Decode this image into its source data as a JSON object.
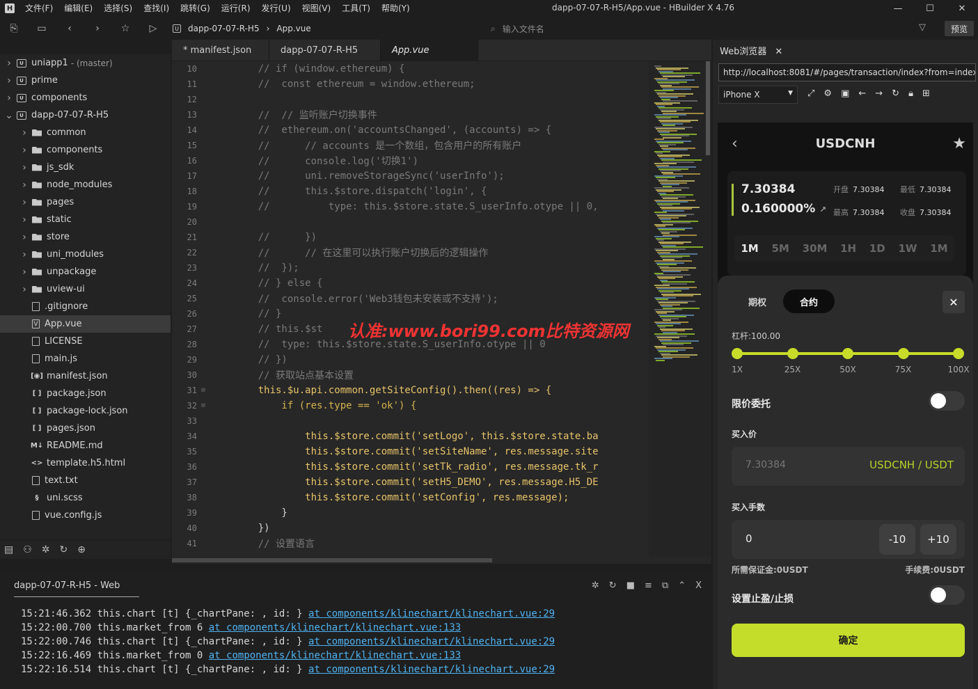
{
  "window": {
    "title": "dapp-07-07-R-H5/App.vue - HBuilder X 4.76",
    "menu": [
      "文件(F)",
      "编辑(E)",
      "选择(S)",
      "查找(I)",
      "跳转(G)",
      "运行(R)",
      "发行(U)",
      "视图(V)",
      "工具(T)",
      "帮助(Y)"
    ]
  },
  "toolbar": {
    "crumb_project": "dapp-07-07-R-H5",
    "crumb_file": "App.vue",
    "file_search_placeholder": "输入文件名",
    "preview_label": "预览"
  },
  "sidebar": {
    "items": [
      {
        "label": "uniapp1",
        "sub": "- (master)",
        "type": "project",
        "arrow": "right"
      },
      {
        "label": "prime",
        "type": "project",
        "arrow": "right"
      },
      {
        "label": "components",
        "type": "project",
        "arrow": "right"
      },
      {
        "label": "dapp-07-07-R-H5",
        "type": "project",
        "arrow": "down"
      },
      {
        "label": "common",
        "type": "folder",
        "arrow": "right"
      },
      {
        "label": "components",
        "type": "folder",
        "arrow": "right"
      },
      {
        "label": "js_sdk",
        "type": "folder",
        "arrow": "right"
      },
      {
        "label": "node_modules",
        "type": "folder",
        "arrow": "right"
      },
      {
        "label": "pages",
        "type": "folder",
        "arrow": "right"
      },
      {
        "label": "static",
        "type": "folder",
        "arrow": "right"
      },
      {
        "label": "store",
        "type": "folder",
        "arrow": "right"
      },
      {
        "label": "uni_modules",
        "type": "folder",
        "arrow": "right"
      },
      {
        "label": "unpackage",
        "type": "folder",
        "arrow": "right"
      },
      {
        "label": "uview-ui",
        "type": "folder",
        "arrow": "right"
      },
      {
        "label": ".gitignore",
        "type": "file"
      },
      {
        "label": "App.vue",
        "type": "vue",
        "selected": true
      },
      {
        "label": "LICENSE",
        "type": "file"
      },
      {
        "label": "main.js",
        "type": "file"
      },
      {
        "label": "manifest.json",
        "type": "manifest"
      },
      {
        "label": "package.json",
        "type": "json"
      },
      {
        "label": "package-lock.json",
        "type": "json"
      },
      {
        "label": "pages.json",
        "type": "json"
      },
      {
        "label": "README.md",
        "type": "md"
      },
      {
        "label": "template.h5.html",
        "type": "html"
      },
      {
        "label": "text.txt",
        "type": "file"
      },
      {
        "label": "uni.scss",
        "type": "scss"
      },
      {
        "label": "vue.config.js",
        "type": "file"
      }
    ]
  },
  "editor": {
    "tabs": [
      {
        "label": "* manifest.json",
        "active": false
      },
      {
        "label": "dapp-07-07-R-H5",
        "active": false
      },
      {
        "label": "App.vue",
        "active": true
      }
    ],
    "lines": [
      {
        "n": "10",
        "t": "    // if (window.ethereum) {"
      },
      {
        "n": "11",
        "t": "    //  const ethereum = window.ethereum;"
      },
      {
        "n": "12",
        "t": ""
      },
      {
        "n": "13",
        "t": "    //  // 监听账户切换事件"
      },
      {
        "n": "14",
        "t": "    //  ethereum.on('accountsChanged', (accounts) => {"
      },
      {
        "n": "15",
        "t": "    //      // accounts 是一个数组，包含用户的所有账户"
      },
      {
        "n": "16",
        "t": "    //      console.log('切换1')"
      },
      {
        "n": "17",
        "t": "    //      uni.removeStorageSync('userInfo');"
      },
      {
        "n": "18",
        "t": "    //      this.$store.dispatch('login', {"
      },
      {
        "n": "19",
        "t": "    //          type: this.$store.state.S_userInfo.otype || 0,"
      },
      {
        "n": "20",
        "t": ""
      },
      {
        "n": "21",
        "t": "    //      })"
      },
      {
        "n": "22",
        "t": "    //      // 在这里可以执行账户切换后的逻辑操作"
      },
      {
        "n": "23",
        "t": "    //  });"
      },
      {
        "n": "24",
        "t": "    // } else {"
      },
      {
        "n": "25",
        "t": "    //  console.error('Web3钱包未安装或不支持');"
      },
      {
        "n": "26",
        "t": "    // }"
      },
      {
        "n": "27",
        "t": "    // this.$st"
      },
      {
        "n": "28",
        "t": "    //  type: this.$store.state.S_userInfo.otype || 0"
      },
      {
        "n": "29",
        "t": "    // })"
      },
      {
        "n": "30",
        "t": "    // 获取站点基本设置"
      },
      {
        "n": "31",
        "t": "    this.$u.api.common.getSiteConfig().then((res) => {"
      },
      {
        "n": "32",
        "t": "        if (res.type == 'ok') {"
      },
      {
        "n": "33",
        "t": ""
      },
      {
        "n": "34",
        "t": "            this.$store.commit('setLogo', this.$store.state.ba"
      },
      {
        "n": "35",
        "t": "            this.$store.commit('setSiteName', res.message.site"
      },
      {
        "n": "36",
        "t": "            this.$store.commit('setTk_radio', res.message.tk_r"
      },
      {
        "n": "37",
        "t": "            this.$store.commit('setH5_DEMO', res.message.H5_DE"
      },
      {
        "n": "38",
        "t": "            this.$store.commit('setConfig', res.message);"
      },
      {
        "n": "39",
        "t": "        }"
      },
      {
        "n": "40",
        "t": "    })"
      },
      {
        "n": "41",
        "t": "    // 设置语言"
      }
    ],
    "watermark": "认准:www.bori99.com比特资源网"
  },
  "console": {
    "tab_label": "dapp-07-07-R-H5 - Web",
    "lines": [
      {
        "time": "15:21:46.362",
        "text": "this.chart [t] {_chartPane: , id: }",
        "link": "at components/klinechart/klinechart.vue:29"
      },
      {
        "time": "15:22:00.700",
        "text": "this.market_from 6",
        "link": "at components/klinechart/klinechart.vue:133"
      },
      {
        "time": "15:22:00.746",
        "text": "this.chart [t] {_chartPane: , id: }",
        "link": "at components/klinechart/klinechart.vue:29"
      },
      {
        "time": "15:22:16.469",
        "text": "this.market_from 0",
        "link": "at components/klinechart/klinechart.vue:133"
      },
      {
        "time": "15:22:16.514",
        "text": "this.chart [t] {_chartPane: , id: }",
        "link": "at components/klinechart/klinechart.vue:29"
      }
    ]
  },
  "browser": {
    "tab_label": "Web浏览器",
    "url": "http://localhost:8081/#/pages/transaction/index?from=index&",
    "device": "iPhone X"
  },
  "app": {
    "title": "USDCNH",
    "price": "7.30384",
    "change": "0.160000%",
    "stats": [
      {
        "k": "开盘",
        "v": "7.30384"
      },
      {
        "k": "最低",
        "v": "7.30384"
      },
      {
        "k": "最高",
        "v": "7.30384"
      },
      {
        "k": "收盘",
        "v": "7.30384"
      }
    ],
    "periods": [
      "1M",
      "5M",
      "30M",
      "1H",
      "1D",
      "1W",
      "1M"
    ],
    "segments": [
      "期权",
      "合约"
    ],
    "leverage_label": "杠杆:100.00",
    "leverage_ticks": [
      "1X",
      "25X",
      "50X",
      "75X",
      "100X"
    ],
    "leverage_fraction": 1.0,
    "limit_label": "限价委托",
    "limit_on": false,
    "buy_price_label": "买入价",
    "buy_price_placeholder": "7.30384",
    "pair": "USDCNH / USDT",
    "qty_label": "买入手数",
    "qty_value": "0",
    "minus_label": "-10",
    "plus_label": "+10",
    "margin_label": "所需保证金:0USDT",
    "fee_label": "手续费:0USDT",
    "tp_sl_label": "设置止盈/止损",
    "tp_sl_on": false,
    "confirm_label": "确定",
    "accent": "#c4dd2b"
  }
}
